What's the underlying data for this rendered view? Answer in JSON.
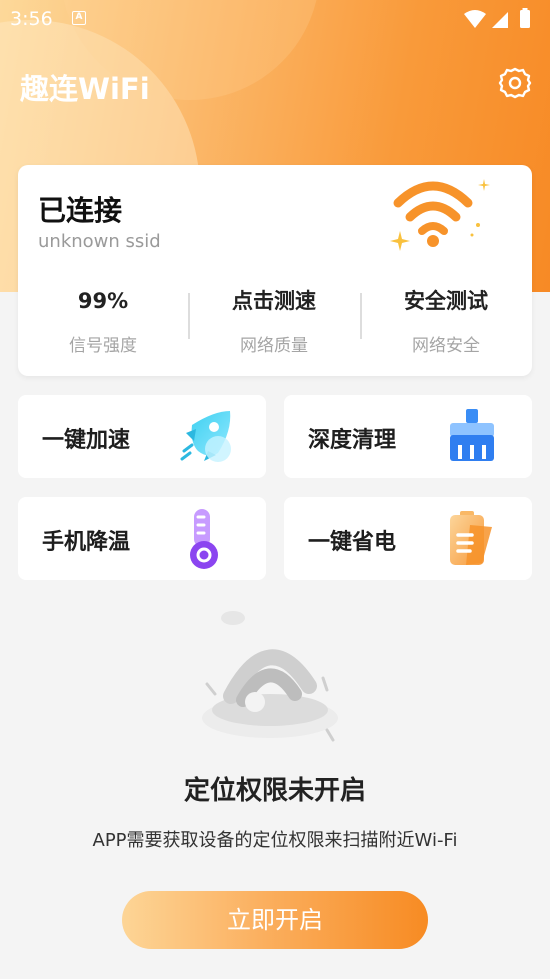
{
  "status_bar": {
    "time": "3:56",
    "notification_icon": "A",
    "icons": [
      "wifi-icon",
      "signal-icon",
      "battery-icon"
    ]
  },
  "header": {
    "title": "趣连WiFi",
    "settings_icon": "gear-icon"
  },
  "connection": {
    "status": "已连接",
    "ssid": "unknown ssid",
    "stats": [
      {
        "value": "99%",
        "label": "信号强度"
      },
      {
        "value": "点击测速",
        "label": "网络质量"
      },
      {
        "value": "安全测试",
        "label": "网络安全"
      }
    ]
  },
  "features": [
    {
      "label": "一键加速",
      "icon": "rocket-icon"
    },
    {
      "label": "深度清理",
      "icon": "broom-icon"
    },
    {
      "label": "手机降温",
      "icon": "thermometer-icon"
    },
    {
      "label": "一键省电",
      "icon": "battery-saver-icon"
    }
  ],
  "permission": {
    "title": "定位权限未开启",
    "description": "APP需要获取设备的定位权限来扫描附近Wi-Fi",
    "button_label": "立即开启"
  },
  "colors": {
    "accent": "#f78a25",
    "accent_light": "#fdd596",
    "purple": "#8b5cf6",
    "blue": "#2f7ef0"
  }
}
